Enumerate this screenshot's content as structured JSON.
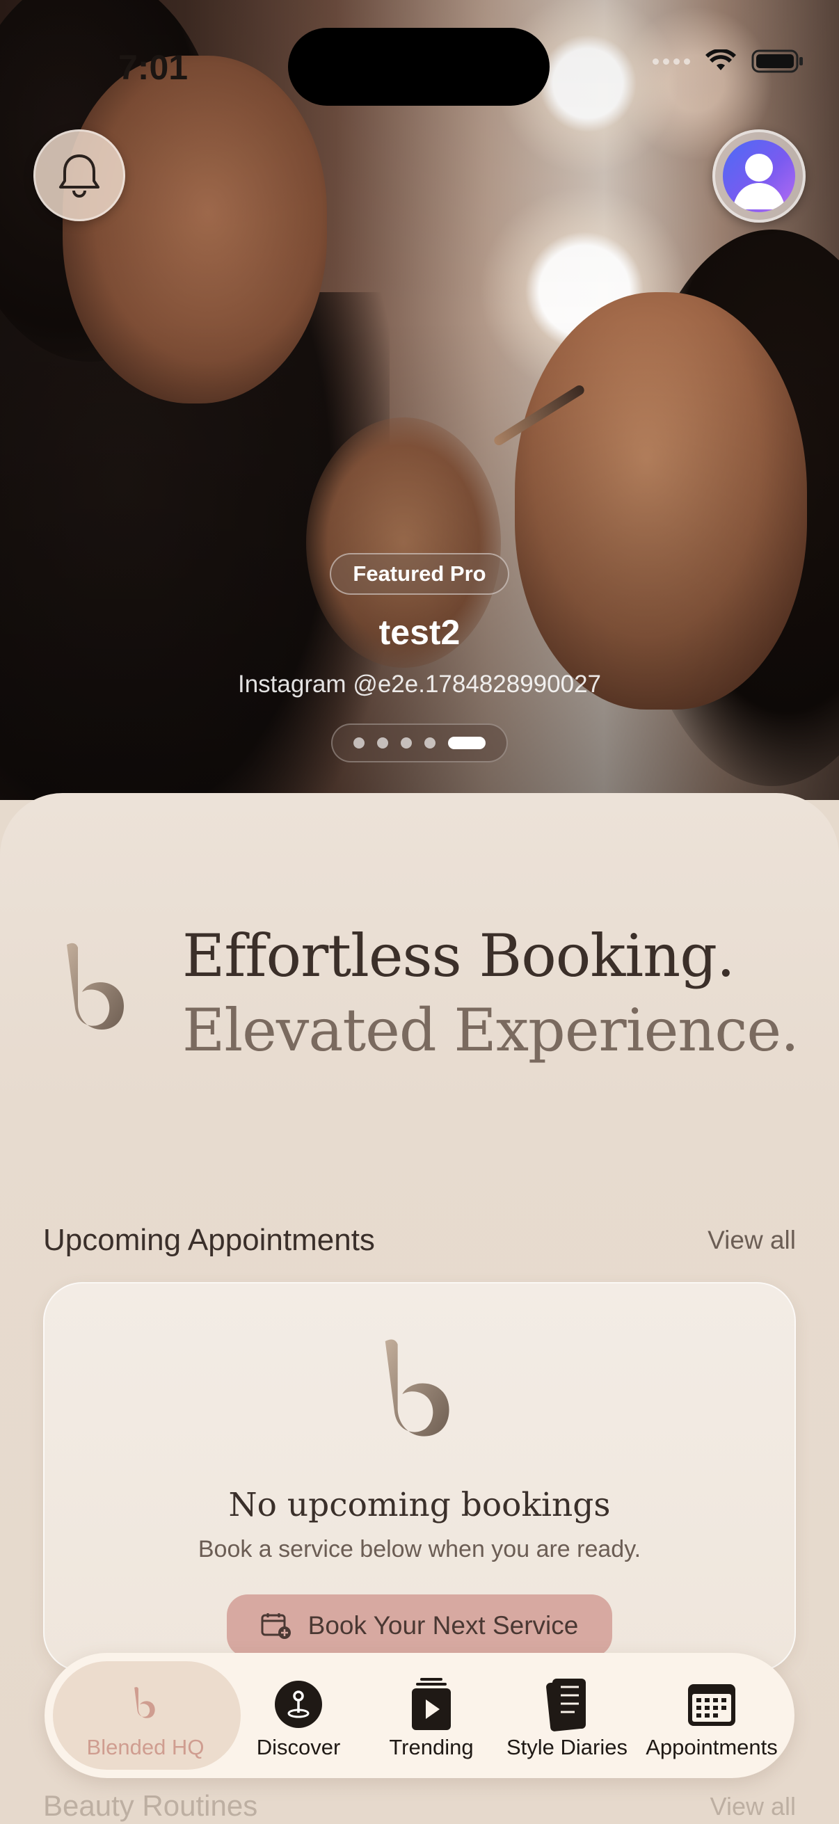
{
  "status_bar": {
    "time": "7:01"
  },
  "hero": {
    "badge": "Featured Pro",
    "name": "test2",
    "handle": "Instagram @e2e.1784828990027",
    "pager": {
      "count": 5,
      "active_index": 4
    }
  },
  "headline": {
    "line1": "Effortless Booking.",
    "line2": "Elevated Experience."
  },
  "appointments": {
    "title": "Upcoming Appointments",
    "view_all": "View all",
    "empty_title": "No upcoming bookings",
    "empty_subtitle": "Book a service below when you are ready.",
    "cta": "Book Your Next Service"
  },
  "routines": {
    "title": "Beauty Routines",
    "view_all": "View all"
  },
  "tabbar": {
    "active_index": 0,
    "items": [
      {
        "label": "Blended HQ",
        "icon": "blended-logo-icon"
      },
      {
        "label": "Discover",
        "icon": "map-pin-icon"
      },
      {
        "label": "Trending",
        "icon": "play-stack-icon"
      },
      {
        "label": "Style Diaries",
        "icon": "notebook-icon"
      },
      {
        "label": "Appointments",
        "icon": "calendar-icon"
      }
    ]
  },
  "colors": {
    "sheet_bg": "#e6d9cc",
    "accent_rose": "#d7a9a1",
    "active_tab_label": "#cf9d90",
    "text_primary": "#3a2f2a"
  }
}
